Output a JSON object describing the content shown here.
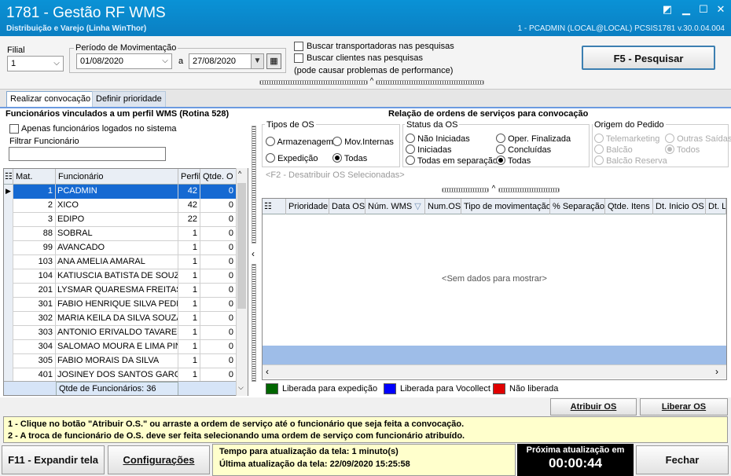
{
  "window": {
    "title": "1781 - Gestão RF WMS",
    "subtitle": "Distribuição e Varejo (Linha WinThor)",
    "session": "1 - PCADMIN (LOCAL@LOCAL)   PCSIS1781  v.30.0.04.004"
  },
  "filters": {
    "filial_label": "Filial",
    "filial_value": "1",
    "periodo_label": "Período de Movimentação",
    "date_from": "01/08/2020",
    "date_sep": "a",
    "date_to": "27/08/2020",
    "chk_transportadoras": "Buscar transportadoras nas pesquisas",
    "chk_clientes": "Buscar clientes nas pesquisas",
    "perf_note": "(pode causar problemas de performance)",
    "search_button": "F5 - Pesquisar"
  },
  "tabs": [
    "Realizar convocação",
    "Definir prioridade"
  ],
  "left": {
    "title": "Funcionários vinculados a um perfil WMS  (Rotina 528)",
    "chk_logados": "Apenas funcionários logados no sistema",
    "filter_label": "Filtrar Funcionário",
    "columns": [
      "Mat.",
      "Funcionário",
      "Perfil",
      "Qtde. O"
    ],
    "rows": [
      [
        "1",
        "PCADMIN",
        "42",
        "0"
      ],
      [
        "2",
        "XICO",
        "42",
        "0"
      ],
      [
        "3",
        "EDIPO",
        "22",
        "0"
      ],
      [
        "88",
        "SOBRAL",
        "1",
        "0"
      ],
      [
        "99",
        "AVANCADO",
        "1",
        "0"
      ],
      [
        "103",
        "ANA AMELIA AMARAL",
        "1",
        "0"
      ],
      [
        "104",
        "KATIUSCIA BATISTA DE SOUZA",
        "1",
        "0"
      ],
      [
        "201",
        "LYSMAR QUARESMA FREITAS",
        "1",
        "0"
      ],
      [
        "301",
        "FABIO HENRIQUE SILVA PEDRI",
        "1",
        "0"
      ],
      [
        "302",
        "MARIA KEILA DA SILVA SOUZA",
        "1",
        "0"
      ],
      [
        "303",
        "ANTONIO ERIVALDO TAVARES",
        "1",
        "0"
      ],
      [
        "304",
        "SALOMAO MOURA E LIMA PINT",
        "1",
        "0"
      ],
      [
        "305",
        "FABIO MORAIS DA SILVA",
        "1",
        "0"
      ],
      [
        "401",
        "JOSINEY DOS SANTOS GARCIA",
        "1",
        "0"
      ]
    ],
    "footer": "Qtde de Funcionários: 36"
  },
  "right": {
    "title": "Relação de ordens de serviços para convocação",
    "tipos_label": "Tipos de OS",
    "tipos": [
      "Armazenagem",
      "Mov.Internas",
      "Expedição",
      "Todas"
    ],
    "status_label": "Status da OS",
    "status": [
      "Não Iniciadas",
      "Oper. Finalizada",
      "Iniciadas",
      "Concluídas",
      "Todas em separação",
      "Todas"
    ],
    "origem_label": "Origem do Pedido",
    "origem": [
      "Telemarketing",
      "Outras Saídas",
      "Balcão",
      "Todos",
      "Balcão Reserva"
    ],
    "f2_hint": "<F2 - Desatribuir OS Selecionadas>",
    "columns": [
      "Prioridade",
      "Data OS",
      "Núm. WMS",
      "Num.OS",
      "Tipo de movimentação",
      "% Separação",
      "Qtde. Itens",
      "Dt. Inicio OS",
      "Dt. L"
    ],
    "empty": "<Sem dados para mostrar>",
    "legend": [
      "Liberada para expedição",
      "Liberada para Vocollect",
      "Não liberada"
    ],
    "legend_colors": [
      "#006600",
      "#0000ff",
      "#e00000"
    ],
    "atribuir_button": "Atribuir OS",
    "liberar_button": "Liberar OS"
  },
  "info": {
    "line1": "1 - Clique no botão \"Atribuir O.S.\" ou arraste a ordem de serviço até o funcionário que seja feita a convocação.",
    "line2": "2 - A troca de funcionário de O.S. deve ser feita selecionando uma ordem de serviço com funcionário atribuído."
  },
  "bottom": {
    "expand_button": "F11 - Expandir tela",
    "config_button": "Configurações",
    "refresh_interval": "Tempo para atualização da tela: 1 minuto(s)",
    "last_update": "Última atualização da tela: 22/09/2020 15:25:58",
    "next_label": "Próxima atualização em",
    "next_value": "00:00:44",
    "close_button": "Fechar"
  }
}
